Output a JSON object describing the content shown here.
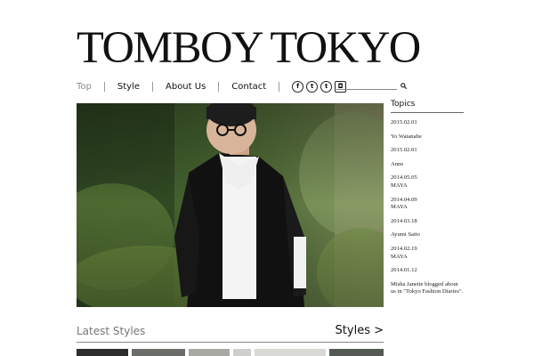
{
  "site": {
    "title": "TOMBOY TOKYO"
  },
  "nav": {
    "items": [
      {
        "label": "Top",
        "active": true
      },
      {
        "label": "Style",
        "active": false
      },
      {
        "label": "About Us",
        "active": false
      },
      {
        "label": "Contact",
        "active": false
      }
    ],
    "social_icons": [
      "facebook-icon",
      "twitter-icon",
      "tumblr-icon",
      "instagram-icon"
    ]
  },
  "search": {
    "placeholder": ""
  },
  "topics": {
    "heading": "Topics",
    "items": [
      {
        "date": "2015.02.01",
        "title": "Yo Watanabe"
      },
      {
        "date": "2015.02.01",
        "title": "Anne"
      },
      {
        "date": "2014.05.05",
        "title": "MAYA"
      },
      {
        "date": "2014.04.09",
        "title": "MAYA"
      },
      {
        "date": "2014.03.18",
        "title": "Ayumi Saito"
      },
      {
        "date": "2014.02.19",
        "title": "MAYA"
      },
      {
        "date": "2014.01.12",
        "title": "Misha Janette blogged about us in \"Tokyo Fashion Diaries\"."
      }
    ]
  },
  "latest": {
    "title": "Latest Styles",
    "link_label": "Styles >"
  },
  "colors": {
    "text": "#111111",
    "muted": "#8a8a8a",
    "rule": "#888888",
    "background": "#ffffff"
  }
}
